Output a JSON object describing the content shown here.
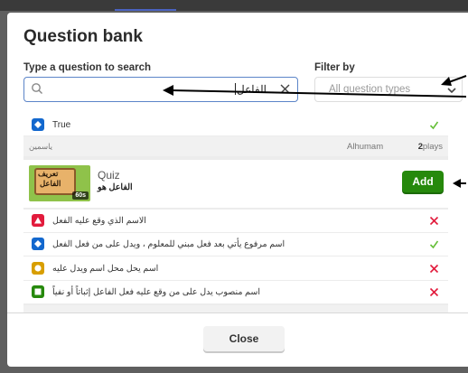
{
  "modal": {
    "title": "Question bank",
    "search": {
      "label": "Type a question to search",
      "value": "الفاعل"
    },
    "filter": {
      "label": "Filter by",
      "placeholder": "All question types"
    },
    "close_label": "Close"
  },
  "top_item": {
    "answer": {
      "text": "True",
      "badge_color": "#1368ce",
      "correct": true
    },
    "title": "ياسمين",
    "author": "Alhumam",
    "plays_count": "2",
    "plays_unit": "plays"
  },
  "quiz_item": {
    "thumbnail": {
      "line1": "تعريف",
      "line2": "الفاعل",
      "duration": "60s"
    },
    "type_label": "Quiz",
    "title": "الفاعل هو",
    "add_label": "Add",
    "answers": [
      {
        "text": "الاسم الذي وقع عليه الفعل",
        "color": "#e21b3c",
        "shape": "triangle-icon",
        "correct": false
      },
      {
        "text": "اسم مرفوع يأتي بعد فعل مبني للمعلوم ، ويدل على من فعل الفعل",
        "color": "#1368ce",
        "shape": "diamond-icon",
        "correct": true
      },
      {
        "text": "اسم يحل محل اسم ويدل عليه",
        "color": "#d89e00",
        "shape": "circle-icon",
        "correct": false
      },
      {
        "text": "اسم منصوب يدل على من وقع عليه فعل الفاعل إثباتاً أو نفياً",
        "color": "#26890c",
        "shape": "square-icon",
        "correct": false
      }
    ]
  },
  "colors": {
    "accent_green": "#26890c",
    "correct": "#66bf39",
    "wrong": "#e21b3c",
    "focus_blue": "#5c85c8"
  }
}
